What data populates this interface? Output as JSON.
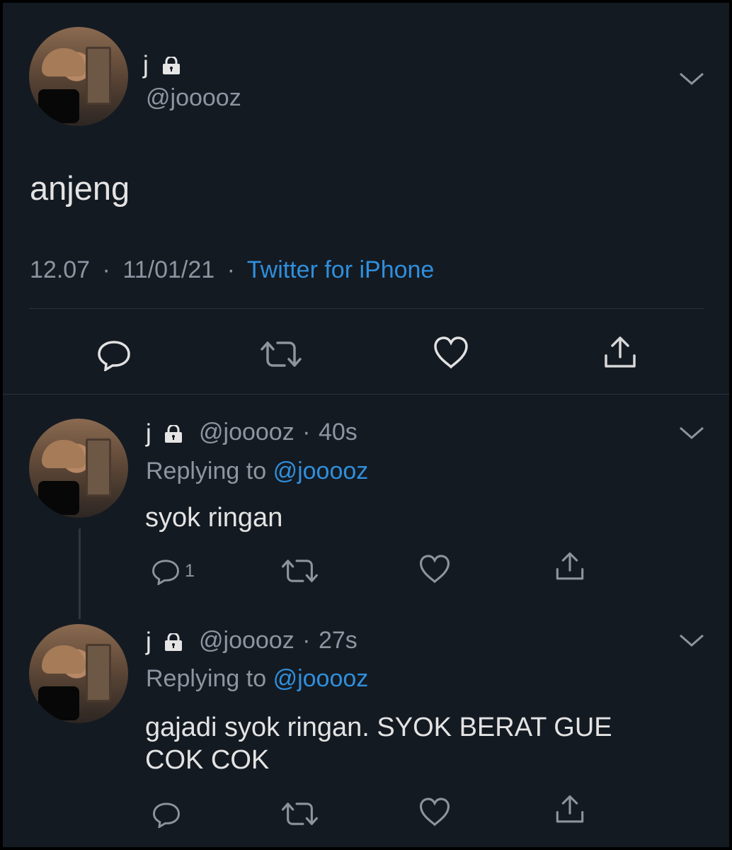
{
  "main_tweet": {
    "display_name": "j",
    "handle": "@jooooz",
    "text": "anjeng",
    "time": "12.07",
    "date": "11/01/21",
    "source": "Twitter for iPhone",
    "actions": {
      "reply_icon": "reply-icon",
      "retweet_icon": "retweet-icon",
      "like_icon": "heart-icon",
      "share_icon": "share-icon"
    }
  },
  "replies": [
    {
      "display_name": "j",
      "handle": "@jooooz",
      "time_ago": "40s",
      "replying_label": "Replying to",
      "replying_handle": "@jooooz",
      "text": "syok ringan",
      "reply_count": "1"
    },
    {
      "display_name": "j",
      "handle": "@jooooz",
      "time_ago": "27s",
      "replying_label": "Replying to",
      "replying_handle": "@jooooz",
      "text_line1": "gajadi syok ringan. SYOK BERAT GUE",
      "text_line2": "COK COK"
    }
  ],
  "separators": {
    "dot": "·"
  },
  "colors": {
    "background": "#141a22",
    "text": "#e3e3e3",
    "muted": "#8d95a1",
    "link": "#2f8fdc",
    "divider": "#2a323c"
  }
}
